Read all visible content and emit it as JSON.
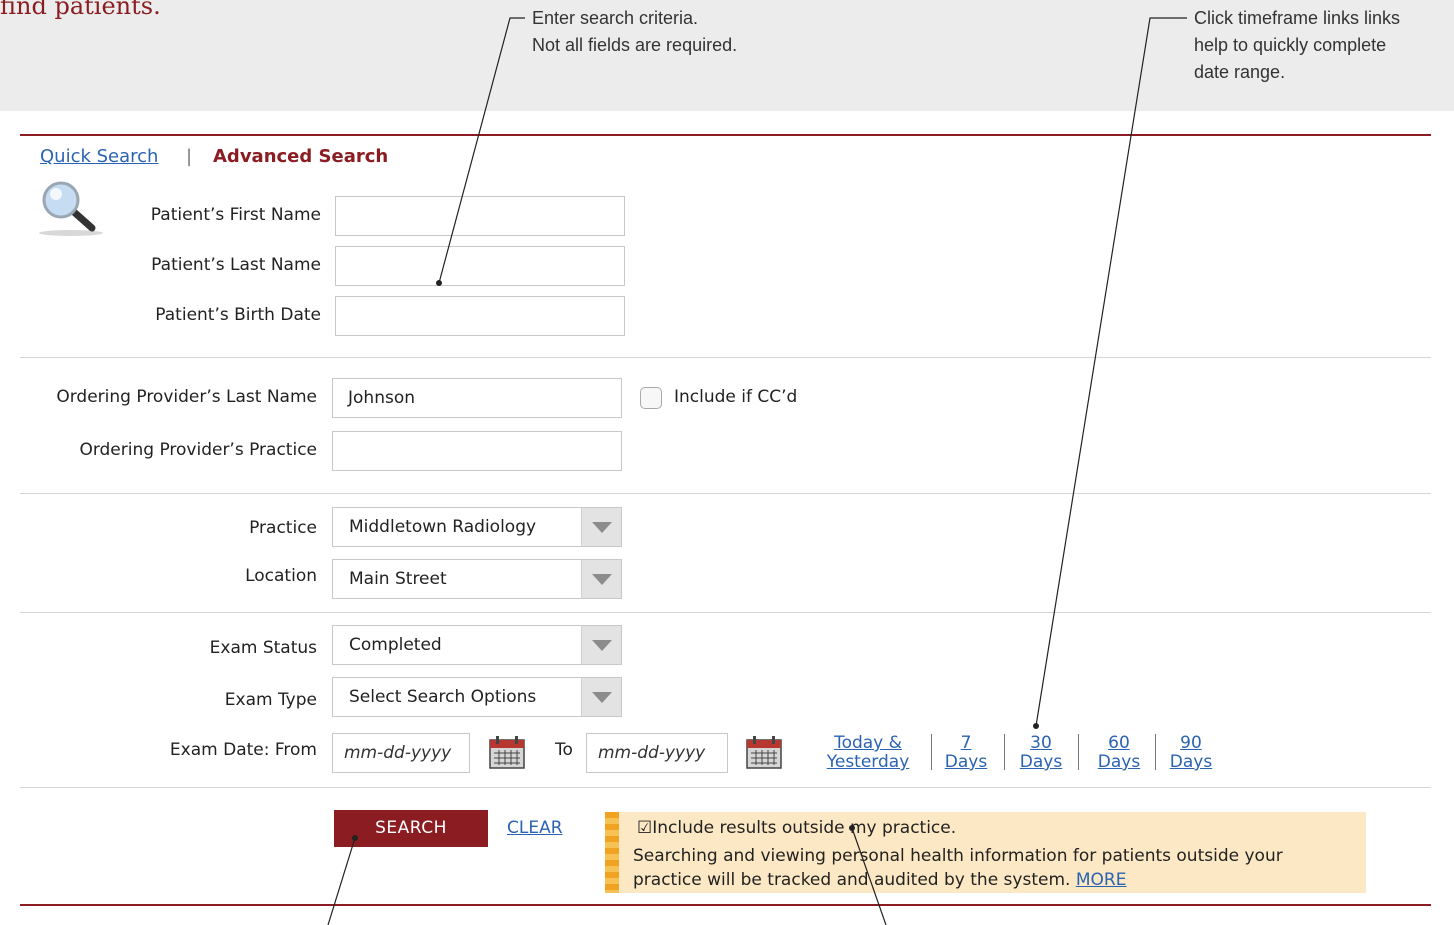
{
  "header": {
    "heading_fragment": "find patients.",
    "callout_fields": "Enter search criteria.\nNot all fields are required.",
    "callout_timeframe": "Click timeframe links links\nhelp to quickly complete\ndate range."
  },
  "tabs": {
    "quick": "Quick Search",
    "separator": "|",
    "advanced": "Advanced Search"
  },
  "patient": {
    "first_name_label": "Patient’s First Name",
    "first_name_value": "",
    "last_name_label": "Patient’s Last Name",
    "last_name_value": "",
    "birth_date_label": "Patient’s Birth Date",
    "birth_date_value": ""
  },
  "provider": {
    "last_name_label": "Ordering Provider’s Last Name",
    "last_name_value": "Johnson",
    "include_cc_label": "Include if CC’d",
    "include_cc_checked": false,
    "practice_label": "Ordering Provider’s Practice",
    "practice_value": ""
  },
  "facility": {
    "practice_label": "Practice",
    "practice_value": "Middletown Radiology",
    "location_label": "Location",
    "location_value": "Main Street"
  },
  "exam": {
    "status_label": "Exam Status",
    "status_value": "Completed",
    "type_label": "Exam Type",
    "type_value": "Select Search Options",
    "date_label": "Exam Date: From",
    "from_placeholder": "mm-dd-yyyy",
    "to_label": "To",
    "to_placeholder": "mm-dd-yyyy"
  },
  "timeframes": [
    {
      "label": "Today &\nYesterday"
    },
    {
      "label": "7\nDays"
    },
    {
      "label": "30\nDays"
    },
    {
      "label": "60\nDays"
    },
    {
      "label": "90\nDays"
    }
  ],
  "actions": {
    "search": "SEARCH",
    "clear": "CLEAR"
  },
  "notice": {
    "checkbox_glyph": "☑",
    "checkbox_label": "Include results outside my practice.",
    "body": "Searching and viewing personal health information for patients outside your practice will be tracked and audited by the system.",
    "more": "MORE"
  },
  "colors": {
    "brand": "#8b1d22",
    "link": "#2b63b3",
    "notice_bg": "#fce8c4",
    "notice_stripe": "#f0a323"
  }
}
